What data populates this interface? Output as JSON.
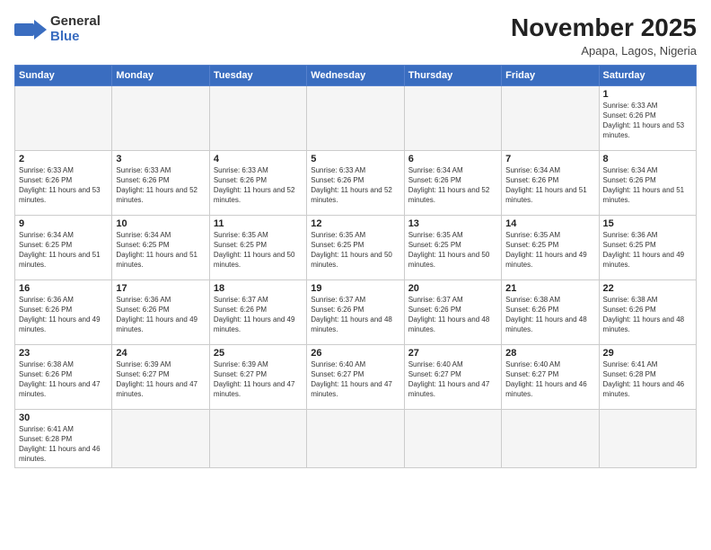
{
  "logo": {
    "text_general": "General",
    "text_blue": "Blue"
  },
  "title": "November 2025",
  "subtitle": "Apapa, Lagos, Nigeria",
  "days_of_week": [
    "Sunday",
    "Monday",
    "Tuesday",
    "Wednesday",
    "Thursday",
    "Friday",
    "Saturday"
  ],
  "weeks": [
    [
      {
        "day": "",
        "empty": true
      },
      {
        "day": "",
        "empty": true
      },
      {
        "day": "",
        "empty": true
      },
      {
        "day": "",
        "empty": true
      },
      {
        "day": "",
        "empty": true
      },
      {
        "day": "",
        "empty": true
      },
      {
        "day": "1",
        "sunrise": "Sunrise: 6:33 AM",
        "sunset": "Sunset: 6:26 PM",
        "daylight": "Daylight: 11 hours and 53 minutes."
      }
    ],
    [
      {
        "day": "2",
        "sunrise": "Sunrise: 6:33 AM",
        "sunset": "Sunset: 6:26 PM",
        "daylight": "Daylight: 11 hours and 53 minutes."
      },
      {
        "day": "3",
        "sunrise": "Sunrise: 6:33 AM",
        "sunset": "Sunset: 6:26 PM",
        "daylight": "Daylight: 11 hours and 52 minutes."
      },
      {
        "day": "4",
        "sunrise": "Sunrise: 6:33 AM",
        "sunset": "Sunset: 6:26 PM",
        "daylight": "Daylight: 11 hours and 52 minutes."
      },
      {
        "day": "5",
        "sunrise": "Sunrise: 6:33 AM",
        "sunset": "Sunset: 6:26 PM",
        "daylight": "Daylight: 11 hours and 52 minutes."
      },
      {
        "day": "6",
        "sunrise": "Sunrise: 6:34 AM",
        "sunset": "Sunset: 6:26 PM",
        "daylight": "Daylight: 11 hours and 52 minutes."
      },
      {
        "day": "7",
        "sunrise": "Sunrise: 6:34 AM",
        "sunset": "Sunset: 6:26 PM",
        "daylight": "Daylight: 11 hours and 51 minutes."
      },
      {
        "day": "8",
        "sunrise": "Sunrise: 6:34 AM",
        "sunset": "Sunset: 6:26 PM",
        "daylight": "Daylight: 11 hours and 51 minutes."
      }
    ],
    [
      {
        "day": "9",
        "sunrise": "Sunrise: 6:34 AM",
        "sunset": "Sunset: 6:25 PM",
        "daylight": "Daylight: 11 hours and 51 minutes."
      },
      {
        "day": "10",
        "sunrise": "Sunrise: 6:34 AM",
        "sunset": "Sunset: 6:25 PM",
        "daylight": "Daylight: 11 hours and 51 minutes."
      },
      {
        "day": "11",
        "sunrise": "Sunrise: 6:35 AM",
        "sunset": "Sunset: 6:25 PM",
        "daylight": "Daylight: 11 hours and 50 minutes."
      },
      {
        "day": "12",
        "sunrise": "Sunrise: 6:35 AM",
        "sunset": "Sunset: 6:25 PM",
        "daylight": "Daylight: 11 hours and 50 minutes."
      },
      {
        "day": "13",
        "sunrise": "Sunrise: 6:35 AM",
        "sunset": "Sunset: 6:25 PM",
        "daylight": "Daylight: 11 hours and 50 minutes."
      },
      {
        "day": "14",
        "sunrise": "Sunrise: 6:35 AM",
        "sunset": "Sunset: 6:25 PM",
        "daylight": "Daylight: 11 hours and 49 minutes."
      },
      {
        "day": "15",
        "sunrise": "Sunrise: 6:36 AM",
        "sunset": "Sunset: 6:25 PM",
        "daylight": "Daylight: 11 hours and 49 minutes."
      }
    ],
    [
      {
        "day": "16",
        "sunrise": "Sunrise: 6:36 AM",
        "sunset": "Sunset: 6:26 PM",
        "daylight": "Daylight: 11 hours and 49 minutes."
      },
      {
        "day": "17",
        "sunrise": "Sunrise: 6:36 AM",
        "sunset": "Sunset: 6:26 PM",
        "daylight": "Daylight: 11 hours and 49 minutes."
      },
      {
        "day": "18",
        "sunrise": "Sunrise: 6:37 AM",
        "sunset": "Sunset: 6:26 PM",
        "daylight": "Daylight: 11 hours and 49 minutes."
      },
      {
        "day": "19",
        "sunrise": "Sunrise: 6:37 AM",
        "sunset": "Sunset: 6:26 PM",
        "daylight": "Daylight: 11 hours and 48 minutes."
      },
      {
        "day": "20",
        "sunrise": "Sunrise: 6:37 AM",
        "sunset": "Sunset: 6:26 PM",
        "daylight": "Daylight: 11 hours and 48 minutes."
      },
      {
        "day": "21",
        "sunrise": "Sunrise: 6:38 AM",
        "sunset": "Sunset: 6:26 PM",
        "daylight": "Daylight: 11 hours and 48 minutes."
      },
      {
        "day": "22",
        "sunrise": "Sunrise: 6:38 AM",
        "sunset": "Sunset: 6:26 PM",
        "daylight": "Daylight: 11 hours and 48 minutes."
      }
    ],
    [
      {
        "day": "23",
        "sunrise": "Sunrise: 6:38 AM",
        "sunset": "Sunset: 6:26 PM",
        "daylight": "Daylight: 11 hours and 47 minutes."
      },
      {
        "day": "24",
        "sunrise": "Sunrise: 6:39 AM",
        "sunset": "Sunset: 6:27 PM",
        "daylight": "Daylight: 11 hours and 47 minutes."
      },
      {
        "day": "25",
        "sunrise": "Sunrise: 6:39 AM",
        "sunset": "Sunset: 6:27 PM",
        "daylight": "Daylight: 11 hours and 47 minutes."
      },
      {
        "day": "26",
        "sunrise": "Sunrise: 6:40 AM",
        "sunset": "Sunset: 6:27 PM",
        "daylight": "Daylight: 11 hours and 47 minutes."
      },
      {
        "day": "27",
        "sunrise": "Sunrise: 6:40 AM",
        "sunset": "Sunset: 6:27 PM",
        "daylight": "Daylight: 11 hours and 47 minutes."
      },
      {
        "day": "28",
        "sunrise": "Sunrise: 6:40 AM",
        "sunset": "Sunset: 6:27 PM",
        "daylight": "Daylight: 11 hours and 46 minutes."
      },
      {
        "day": "29",
        "sunrise": "Sunrise: 6:41 AM",
        "sunset": "Sunset: 6:28 PM",
        "daylight": "Daylight: 11 hours and 46 minutes."
      }
    ],
    [
      {
        "day": "30",
        "sunrise": "Sunrise: 6:41 AM",
        "sunset": "Sunset: 6:28 PM",
        "daylight": "Daylight: 11 hours and 46 minutes."
      },
      {
        "day": "",
        "empty": true
      },
      {
        "day": "",
        "empty": true
      },
      {
        "day": "",
        "empty": true
      },
      {
        "day": "",
        "empty": true
      },
      {
        "day": "",
        "empty": true
      },
      {
        "day": "",
        "empty": true
      }
    ]
  ]
}
